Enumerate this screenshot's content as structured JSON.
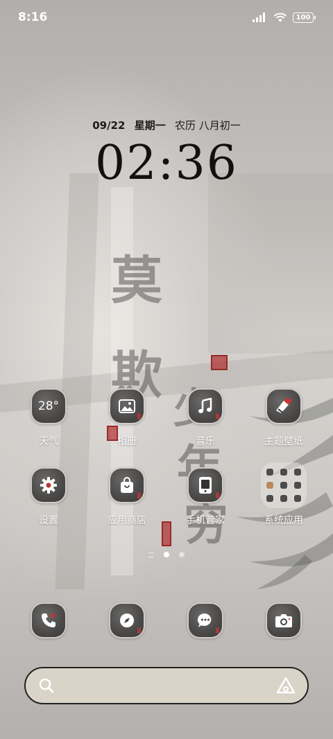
{
  "status_bar": {
    "time": "8:16",
    "battery": "100"
  },
  "clock": {
    "date": "09/22",
    "weekday": "星期一",
    "lunar": "农历 八月初一",
    "time": "02:36"
  },
  "wallpaper": {
    "calligraphy": [
      "莫",
      "欺",
      "少",
      "年",
      "穷"
    ]
  },
  "apps_row1": [
    {
      "label": "天气",
      "icon": "weather-icon",
      "value": "28°"
    },
    {
      "label": "相册",
      "icon": "gallery-icon"
    },
    {
      "label": "音乐",
      "icon": "music-icon"
    },
    {
      "label": "主题壁纸",
      "icon": "theme-icon"
    }
  ],
  "apps_row2": [
    {
      "label": "设置",
      "icon": "settings-icon"
    },
    {
      "label": "应用商店",
      "icon": "app-store-icon"
    },
    {
      "label": "手机管家",
      "icon": "phone-manager-icon"
    },
    {
      "label": "系统应用",
      "icon": "folder-icon"
    }
  ],
  "dock": [
    {
      "icon": "phone-icon"
    },
    {
      "icon": "browser-icon"
    },
    {
      "icon": "messages-icon"
    },
    {
      "icon": "camera-icon"
    }
  ],
  "page_indicator": {
    "pages": 2,
    "active": 1
  },
  "colors": {
    "icon_bg": "#4a4948",
    "accent_red": "#a43a3a",
    "search_bg": "#d9d3c8"
  }
}
